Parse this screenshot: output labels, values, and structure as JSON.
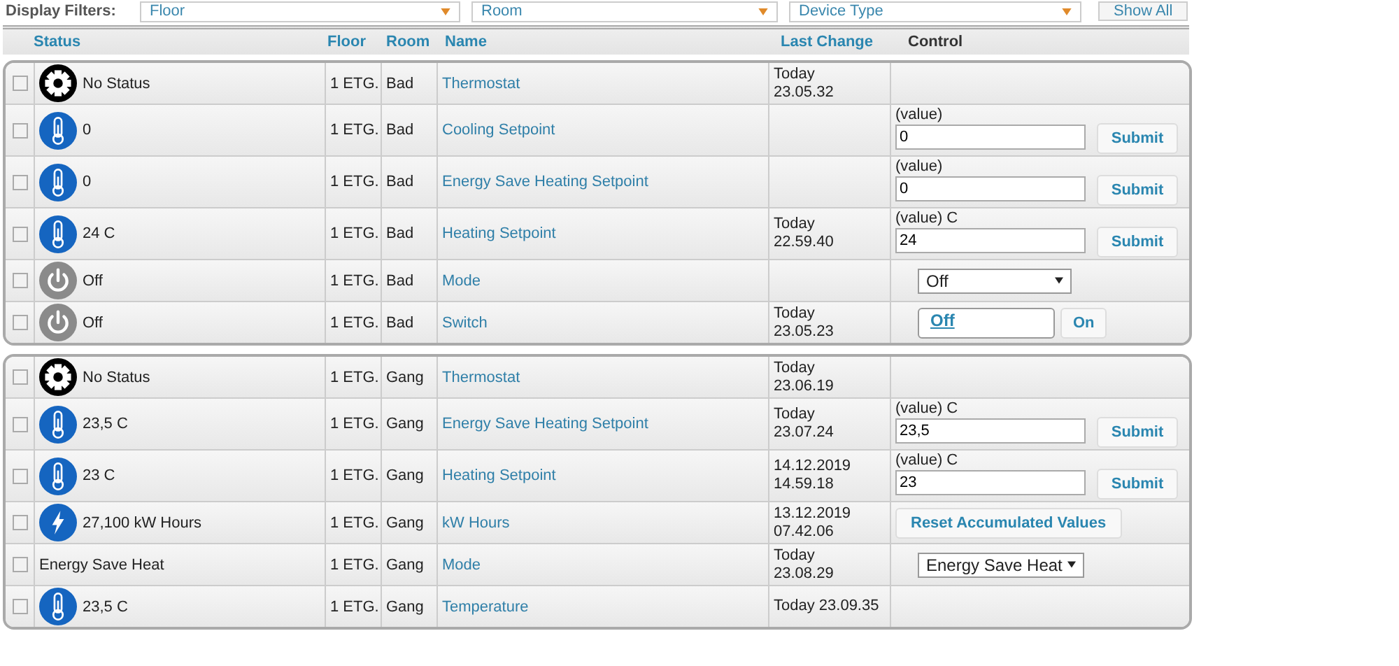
{
  "filters": {
    "label": "Display Filters:",
    "selects": [
      "Floor",
      "Room",
      "Device Type"
    ],
    "button": "Show All"
  },
  "columns": [
    {
      "label": "Status",
      "kind": "sortable"
    },
    {
      "label": "Floor",
      "kind": "sortable"
    },
    {
      "label": "Room",
      "kind": "sortable"
    },
    {
      "label": "Name",
      "kind": "sortable"
    },
    {
      "label": "Last Change",
      "kind": "sortable"
    },
    {
      "label": "Control",
      "kind": "plain"
    }
  ],
  "groups": [
    {
      "rows": [
        {
          "checked": false,
          "kind": "gear",
          "status": "No Status",
          "floor": "1 ETG.",
          "room": "Bad",
          "name": "Thermostat",
          "last_change": [
            "Today",
            "23.05.32"
          ]
        },
        {
          "checked": false,
          "kind": "thermometer",
          "status": "0",
          "floor": "1 ETG.",
          "room": "Bad",
          "name": "Cooling Setpoint",
          "last_change": [],
          "control": {
            "kind": "input",
            "label": "(value)",
            "value": "0",
            "button": "Submit"
          }
        },
        {
          "checked": false,
          "kind": "thermometer",
          "status": "0",
          "floor": "1 ETG.",
          "room": "Bad",
          "name": "Energy Save Heating Setpoint",
          "last_change": [],
          "control": {
            "kind": "input",
            "label": "(value)",
            "value": "0",
            "button": "Submit"
          }
        },
        {
          "checked": false,
          "kind": "thermometer",
          "status": "24 C",
          "floor": "1 ETG.",
          "room": "Bad",
          "name": "Heating Setpoint",
          "last_change": [
            "Today",
            "22.59.40"
          ],
          "control": {
            "kind": "input",
            "label": "(value) C",
            "value": "24",
            "button": "Submit"
          }
        },
        {
          "checked": false,
          "kind": "power",
          "status": "Off",
          "floor": "1 ETG.",
          "room": "Bad",
          "name": "Mode",
          "last_change": [],
          "control": {
            "kind": "select",
            "value": "Off"
          }
        },
        {
          "checked": false,
          "kind": "power",
          "status": "Off",
          "floor": "1 ETG.",
          "room": "Bad",
          "name": "Switch",
          "last_change": [
            "Today",
            "23.05.23"
          ],
          "control": {
            "kind": "buttons",
            "buttons": [
              {
                "label": "Off",
                "selected": true
              },
              {
                "label": "On",
                "selected": false
              }
            ]
          }
        }
      ]
    },
    {
      "rows": [
        {
          "checked": false,
          "kind": "gear",
          "status": "No Status",
          "floor": "1 ETG.",
          "room": "Gang",
          "name": "Thermostat",
          "last_change": [
            "Today",
            "23.06.19"
          ]
        },
        {
          "checked": false,
          "kind": "thermometer",
          "status": "23,5 C",
          "floor": "1 ETG.",
          "room": "Gang",
          "name": "Energy Save Heating Setpoint",
          "last_change": [
            "Today",
            "23.07.24"
          ],
          "control": {
            "kind": "input",
            "label": "(value) C",
            "value": "23,5",
            "button": "Submit"
          }
        },
        {
          "checked": false,
          "kind": "thermometer",
          "status": "23 C",
          "floor": "1 ETG.",
          "room": "Gang",
          "name": "Heating Setpoint",
          "last_change": [
            "14.12.2019",
            "14.59.18"
          ],
          "control": {
            "kind": "input",
            "label": "(value) C",
            "value": "23",
            "button": "Submit"
          }
        },
        {
          "checked": false,
          "kind": "bolt",
          "status": "27,100 kW Hours",
          "floor": "1 ETG.",
          "room": "Gang",
          "name": "kW Hours",
          "last_change": [
            "13.12.2019",
            "07.42.06"
          ],
          "control": {
            "kind": "button",
            "label": "Reset Accumulated Values"
          }
        },
        {
          "checked": false,
          "kind": "text",
          "status": "Energy Save Heat",
          "floor": "1 ETG.",
          "room": "Gang",
          "name": "Mode",
          "last_change": [
            "Today",
            "23.08.29"
          ],
          "control": {
            "kind": "select",
            "value": "Energy Save Heat"
          }
        },
        {
          "checked": false,
          "kind": "thermometer",
          "status": "23,5 C",
          "floor": "1 ETG.",
          "room": "Gang",
          "name": "Temperature",
          "last_change": [
            "Today 23.09.35"
          ]
        }
      ]
    }
  ]
}
